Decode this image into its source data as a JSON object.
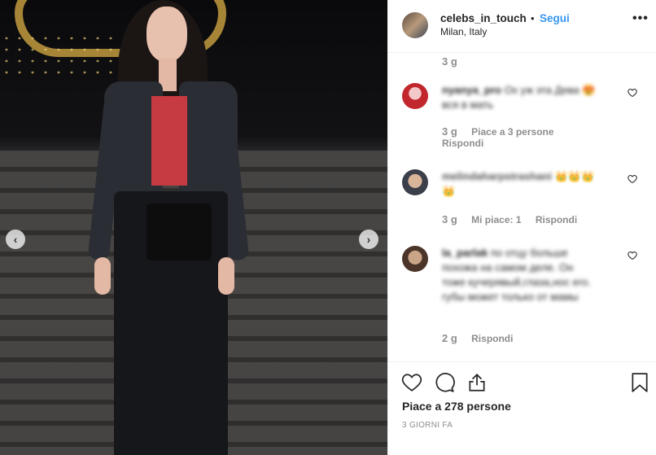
{
  "photo": {
    "prev_glyph": "‹",
    "next_glyph": "›"
  },
  "header": {
    "username": "celebs_in_touch",
    "separator": "•",
    "follow_label": "Segui",
    "location": "Milan, Italy",
    "more_glyph": "•••"
  },
  "comments": {
    "top_time": "3 g",
    "items": [
      {
        "username": "nyanya_pro",
        "text": "Ох уж эта Дева 😍 вся в мать",
        "time": "3 g",
        "likes": "Piace a 3 persone",
        "reply": "Rispondi"
      },
      {
        "username": "melindaharpstrashani",
        "text": "👑👑👑 👑",
        "time": "3 g",
        "likes": "Mi piace: 1",
        "reply": "Rispondi"
      },
      {
        "username": "la_parlak",
        "text": "по отцу больше похожа на самом деле. Он тоже кучерявый,глаза,нос его. губы может только от мамы",
        "time": "2 g",
        "reply": "Rispondi"
      }
    ]
  },
  "actions": {
    "likes": "Piace a 278 persone",
    "date": "3 GIORNI FA"
  },
  "colors": {
    "accent": "#3897f0",
    "text": "#262626",
    "muted": "#8e8e8e",
    "border": "#efefef"
  }
}
